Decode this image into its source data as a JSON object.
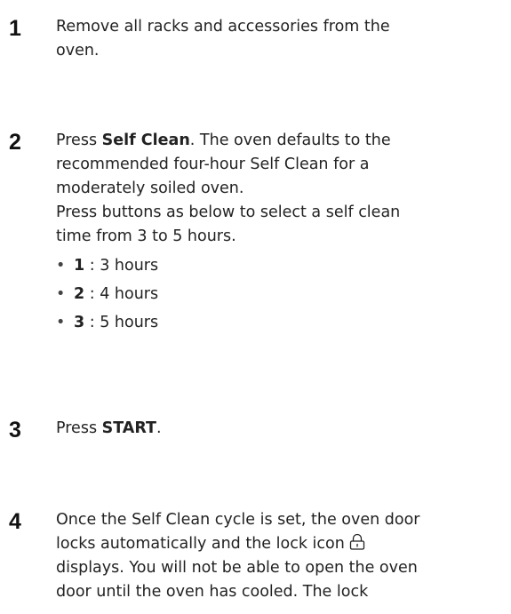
{
  "steps": [
    {
      "number": "1",
      "lines": [
        "Remove all racks and accessories from the",
        "oven."
      ]
    },
    {
      "number": "2",
      "intro_prefix": "Press ",
      "intro_bold": "Self Clean",
      "intro_suffix": ". The oven defaults to the",
      "lines": [
        "recommended four-hour Self Clean for a",
        "moderately soiled oven.",
        "Press buttons as below to select a self clean",
        "time from 3 to 5 hours."
      ],
      "options": [
        {
          "key": "1",
          "text": " : 3 hours"
        },
        {
          "key": "2",
          "text": " : 4 hours"
        },
        {
          "key": "3",
          "text": " : 5 hours"
        }
      ],
      "bullet_char": "•"
    },
    {
      "number": "3",
      "prefix": "Press ",
      "bold": "START",
      "suffix": "."
    },
    {
      "number": "4",
      "line1": "Once the Self Clean cycle is set, the oven door",
      "line2_before_icon": "locks automatically and the lock icon ",
      "icon": "lock-icon",
      "lines_after": [
        "displays. You will not be able to open the oven",
        "door until the oven has cooled. The lock"
      ]
    }
  ]
}
